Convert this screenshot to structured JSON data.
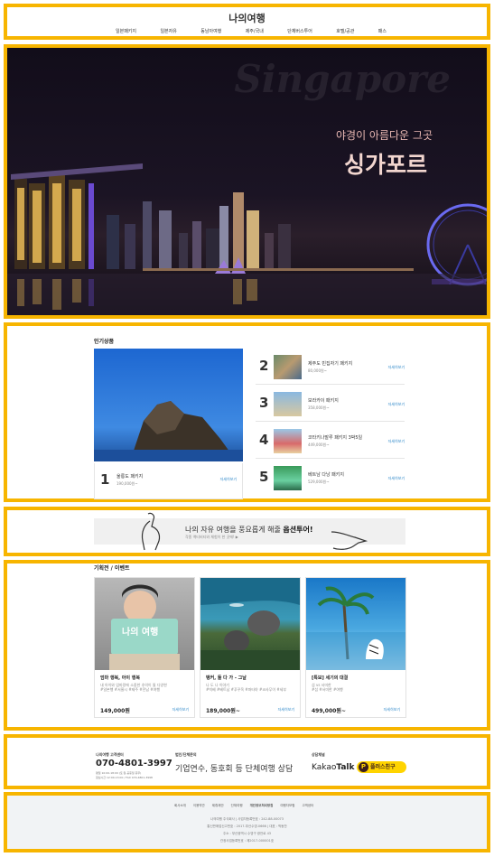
{
  "header": {
    "logo": "나의여행",
    "nav": [
      "일본패키지",
      "일본자유",
      "동남아여행",
      "제주/국내",
      "단체버스투어",
      "호텔/공관",
      "패스"
    ]
  },
  "hero": {
    "bg_word": "Singapore",
    "subtitle": "야경이 아름다운 그곳",
    "title": "싱가포르"
  },
  "popular": {
    "section_title": "인기상품",
    "items": [
      {
        "rank": "1",
        "title": "울릉도 패키지",
        "price": "190,000원~",
        "link": "자세히보기"
      },
      {
        "rank": "2",
        "title": "제주도 빈집자기 패키지",
        "price": "80,000원~",
        "link": "자세히보기"
      },
      {
        "rank": "3",
        "title": "보라카이 패키지",
        "price": "358,000원~",
        "link": "자세히보기"
      },
      {
        "rank": "4",
        "title": "코타키나발루 패키지 3박5일",
        "price": "449,000원~",
        "link": "자세히보기"
      },
      {
        "rank": "5",
        "title": "베트남 다낭 패키지",
        "price": "529,000원~",
        "link": "자세히보기"
      }
    ]
  },
  "banner": {
    "line1_prefix": "나의 자유 여행을 풍요롭게 해줄 ",
    "line1_bold": "옵션투어!",
    "line2": "각종 액티비티와 체험이 한 곳에! ▶"
  },
  "events": {
    "section_title": "기획전 / 이벤트",
    "cards": [
      {
        "image_text": "나의 여행",
        "title": "엄마 행복, 아이 행복",
        "desc": [
          "내 아이와 엄마랑에 소중한 추억이 될 다양한",
          "#일본행 #서울시 #제주 #전남 #여행"
        ],
        "price": "149,000원",
        "link": "자세히보기"
      },
      {
        "title": "뱅커, 둘 다 가 - 그날",
        "desc": [
          "나 도 나 이야기",
          "#빅베 #베트남 #푸꾸옥 #파타야 #코사무이 #세부"
        ],
        "price": "189,000원~",
        "link": "자세히보기"
      },
      {
        "title": "[특보] 세기의 대결",
        "desc": [
          "섬 vs 서미한",
          "#섬 #서미한 #여행"
        ],
        "price": "499,000원~",
        "link": "자세히보기"
      }
    ]
  },
  "contact": {
    "cs_label": "나의여행 고객센터",
    "phone": "070-4801-3997",
    "cs_hours_1": "평일 10:00-18:00 (토·일·공휴일 휴무)",
    "cs_hours_2": "점심시간 12:00-13:00 / FAX 070-4801-3998",
    "group_label": "법인/단체문의",
    "group_text": "기업연수, 동호회 등 단체여행 상담",
    "kakao_label": "상담채널",
    "kakao_text_1": "Kakao",
    "kakao_text_2": "Talk",
    "plus_icon": "P",
    "plus_text": "플러스친구"
  },
  "footer": {
    "links": [
      "회사소개",
      "이용약관",
      "제휴제안",
      "단체여행",
      "개인정보처리방침",
      "여행자보험",
      "고객센터"
    ],
    "info": [
      "나의여행 주식회사 | 사업자등록번호 : 242-88-00073",
      "통신판매업신고번호 : 2017-부산수영-0666 | 대표 : 박동찬",
      "주소 : 부산광역시 수영구 광안로 43",
      "관광사업등록번호 : 제2017-000001호"
    ]
  },
  "colors": {
    "frame": "#f7b500",
    "link": "#2a86c8",
    "kakao_yellow": "#ffd400"
  }
}
